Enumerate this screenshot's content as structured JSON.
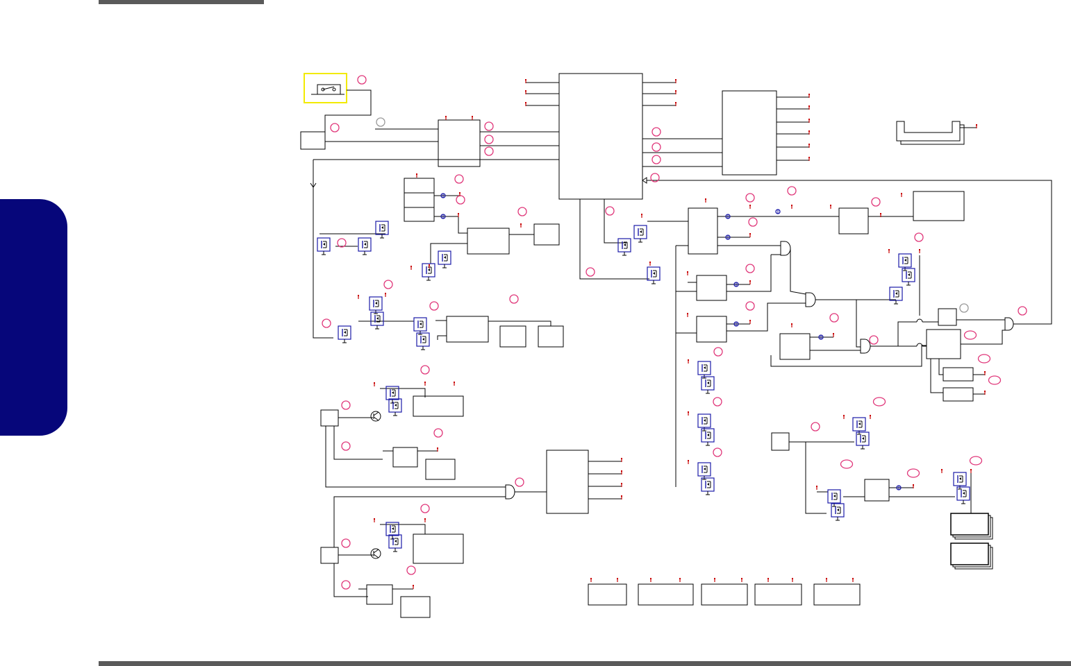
{
  "page": {
    "accent_color": "#06067a",
    "rule_color": "#5a5a5a",
    "wire_color": "#000000",
    "marker_color": "#e0377a",
    "pin_color": "#c80000",
    "fet_color": "#1a1aa8",
    "switch_box_color": "#f2ea00"
  },
  "icons": [
    "switch-icon",
    "mosfet-icon",
    "and-gate-icon",
    "transistor-icon",
    "resistor-icon",
    "ground-icon",
    "connector-icon",
    "callout-marker-icon"
  ]
}
